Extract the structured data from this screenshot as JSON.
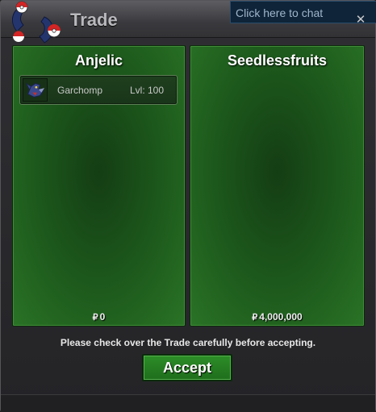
{
  "window": {
    "title": "Trade",
    "logo_icon": "pokeball-emblem-icon",
    "close_icon": "close-icon"
  },
  "chat": {
    "placeholder": "Click here to chat"
  },
  "left_panel": {
    "player_name": "Anjelic",
    "pokemon": [
      {
        "name": "Garchomp",
        "level": "Lvl: 100",
        "sprite_icon": "garchomp-sprite-icon"
      }
    ],
    "currency_symbol": "₽",
    "money": "0"
  },
  "right_panel": {
    "player_name": "Seedlessfruits",
    "pokemon": [],
    "currency_symbol": "₽",
    "money": "4,000,000"
  },
  "footer": {
    "notice": "Please check over the Trade carefully before accepting.",
    "accept_label": "Accept"
  },
  "colors": {
    "panel_green": "#1d5a1c",
    "button_green": "#2d8e28",
    "title_gray": "#b9b9bd",
    "background": "#2a2a2d"
  }
}
